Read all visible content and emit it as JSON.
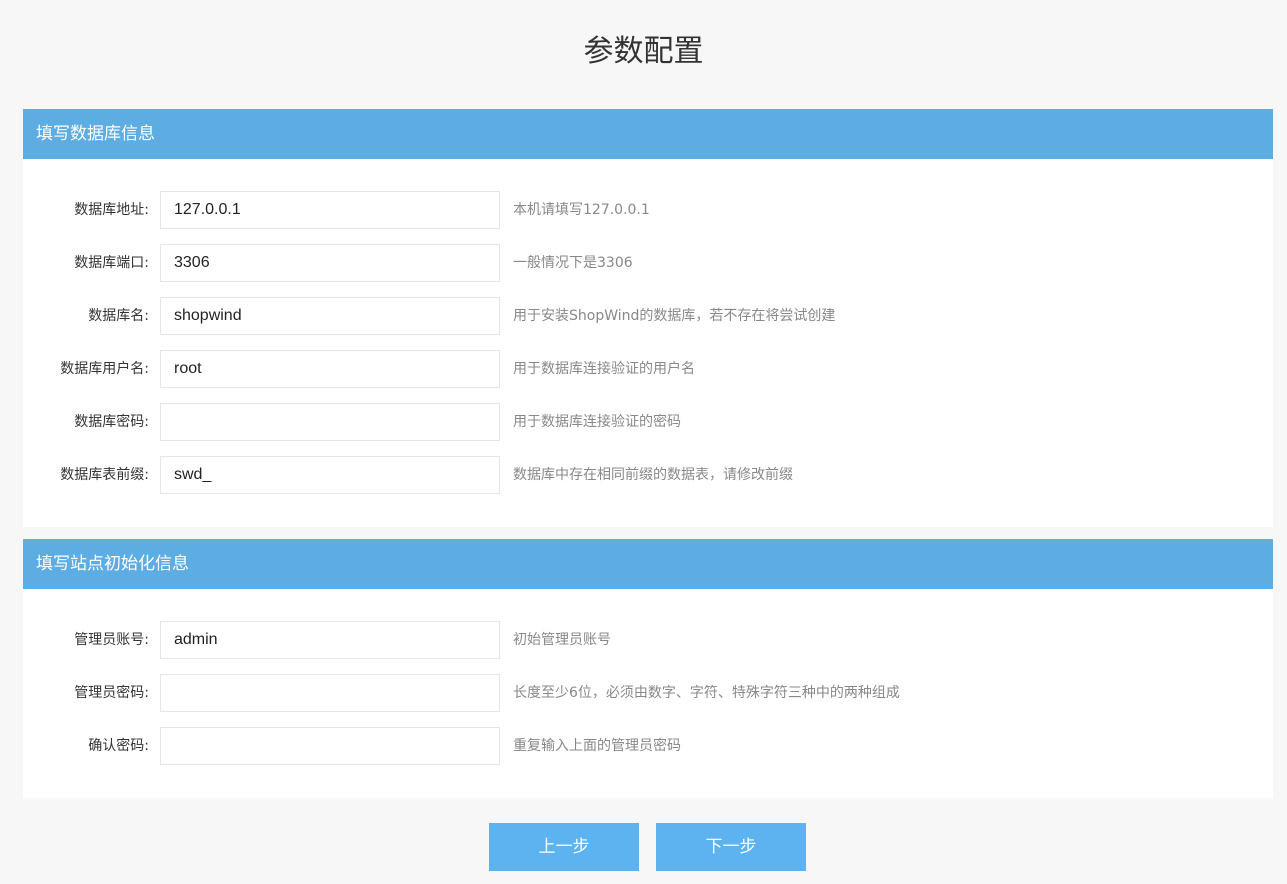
{
  "page": {
    "title": "参数配置"
  },
  "db_section": {
    "heading": "填写数据库信息",
    "fields": [
      {
        "label": "数据库地址:",
        "value": "127.0.0.1",
        "hint": "本机请填写127.0.0.1"
      },
      {
        "label": "数据库端口:",
        "value": "3306",
        "hint": "一般情况下是3306"
      },
      {
        "label": "数据库名:",
        "value": "shopwind",
        "hint": "用于安装ShopWind的数据库，若不存在将尝试创建"
      },
      {
        "label": "数据库用户名:",
        "value": "root",
        "hint": "用于数据库连接验证的用户名"
      },
      {
        "label": "数据库密码:",
        "value": "",
        "hint": "用于数据库连接验证的密码"
      },
      {
        "label": "数据库表前缀:",
        "value": "swd_",
        "hint": "数据库中存在相同前缀的数据表，请修改前缀"
      }
    ]
  },
  "site_section": {
    "heading": "填写站点初始化信息",
    "fields": [
      {
        "label": "管理员账号:",
        "value": "admin",
        "hint": "初始管理员账号"
      },
      {
        "label": "管理员密码:",
        "value": "",
        "hint": "长度至少6位，必须由数字、字符、特殊字符三种中的两种组成"
      },
      {
        "label": "确认密码:",
        "value": "",
        "hint": "重复输入上面的管理员密码"
      }
    ]
  },
  "buttons": {
    "prev": "上一步",
    "next": "下一步"
  },
  "colors": {
    "header": "#5dade2",
    "button": "#5cb3ef",
    "background": "#f7f7f7"
  }
}
